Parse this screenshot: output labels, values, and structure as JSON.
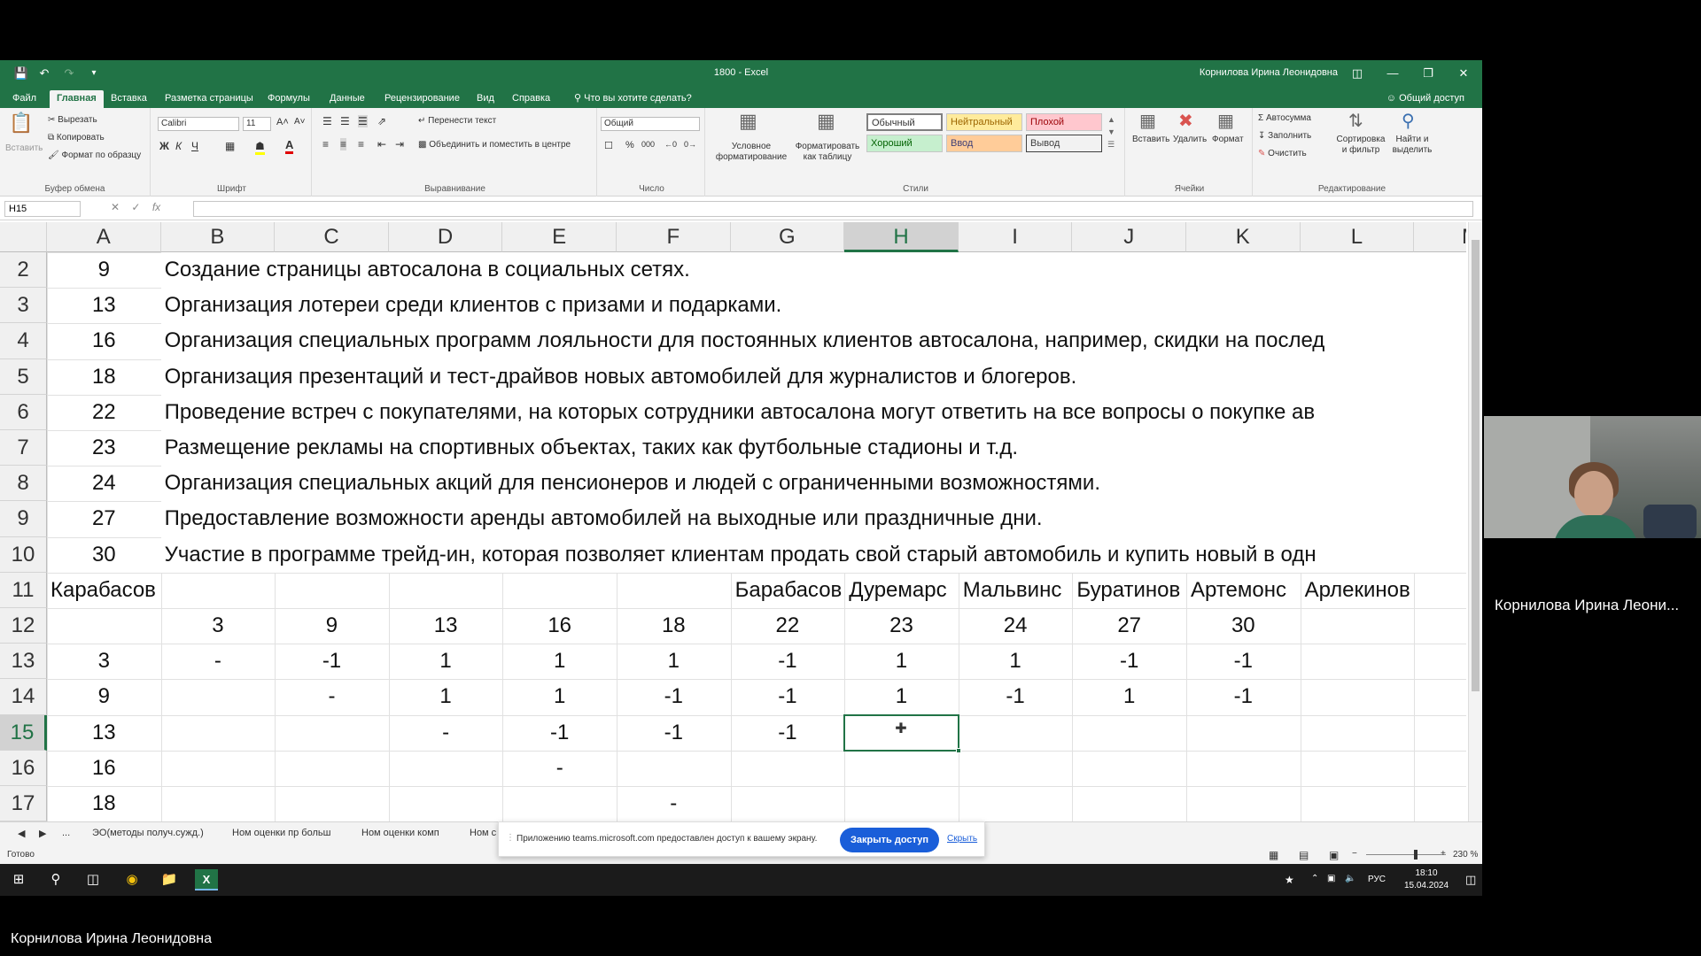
{
  "window": {
    "title": "1800  -  Excel",
    "user": "Корнилова Ирина Леонидовна"
  },
  "tabs": [
    "Файл",
    "Главная",
    "Вставка",
    "Разметка страницы",
    "Формулы",
    "Данные",
    "Рецензирование",
    "Вид",
    "Справка"
  ],
  "tell_me": "Что вы хотите сделать?",
  "share_label": "Общий доступ",
  "ribbon": {
    "clipboard": {
      "paste": "Вставить",
      "cut": "Вырезать",
      "copy": "Копировать",
      "format_painter": "Формат по образцу",
      "group": "Буфер обмена"
    },
    "font": {
      "name": "Calibri",
      "size": "11",
      "group": "Шрифт",
      "bold": "Ж",
      "italic": "К",
      "underline": "Ч"
    },
    "alignment": {
      "wrap": "Перенести текст",
      "merge": "Объединить и поместить в центре",
      "group": "Выравнивание"
    },
    "number": {
      "format": "Общий",
      "group": "Число"
    },
    "styles": {
      "cond": "Условное форматирование",
      "table": "Форматировать как таблицу",
      "normal": "Обычный",
      "neutral": "Нейтральный",
      "bad": "Плохой",
      "good": "Хороший",
      "input": "Ввод",
      "output": "Вывод",
      "group": "Стили",
      "colors": {
        "neutral": "#ffeb9c",
        "bad": "#ffc7ce",
        "good": "#c6efce",
        "input": "#ffcc99",
        "output": "#f2f2f2"
      }
    },
    "cells": {
      "insert": "Вставить",
      "delete": "Удалить",
      "format": "Формат",
      "group": "Ячейки"
    },
    "editing": {
      "autosum": "Автосумма",
      "fill": "Заполнить",
      "clear": "Очистить",
      "sort": "Сортировка и фильтр",
      "find": "Найти и выделить",
      "group": "Редактирование"
    }
  },
  "formula_bar": {
    "name_box": "H15",
    "fx": "fx",
    "value": ""
  },
  "columns": [
    "A",
    "B",
    "C",
    "D",
    "E",
    "F",
    "G",
    "H",
    "I",
    "J",
    "K",
    "L",
    "M"
  ],
  "rows": [
    {
      "n": "2",
      "a": "9",
      "text": "Создание страницы автосалона в социальных сетях."
    },
    {
      "n": "3",
      "a": "13",
      "text": "Организация лотереи среди клиентов с призами и подарками."
    },
    {
      "n": "4",
      "a": "16",
      "text": "Организация специальных программ лояльности для постоянных клиентов автосалона, например, скидки на послед"
    },
    {
      "n": "5",
      "a": "18",
      "text": "Организация презентаций и тест-драйвов новых автомобилей для журналистов и блогеров."
    },
    {
      "n": "6",
      "a": "22",
      "text": "Проведение встреч с покупателями, на которых сотрудники автосалона могут ответить на все вопросы о покупке ав"
    },
    {
      "n": "7",
      "a": "23",
      "text": "Размещение рекламы на спортивных объектах, таких как футбольные стадионы и т.д."
    },
    {
      "n": "8",
      "a": "24",
      "text": "Организация специальных акций для пенсионеров и людей с ограниченными возможностями."
    },
    {
      "n": "9",
      "a": "27",
      "text": "Предоставление возможности аренды автомобилей на выходные или праздничные дни."
    },
    {
      "n": "10",
      "a": "30",
      "text": "Участие в программе трейд-ин, которая позволяет клиентам продать свой старый автомобиль и купить новый в одн"
    }
  ],
  "row11": {
    "n": "11",
    "a": "Карабасов",
    "g": "Барабасов",
    "h": "Дуремарс",
    "i": "Мальвинс",
    "j": "Буратинов",
    "k": "Артемонс",
    "l": "Арлекинов"
  },
  "matrix_rows": [
    {
      "n": "12",
      "a": "",
      "cells": [
        "3",
        "9",
        "13",
        "16",
        "18",
        "22",
        "23",
        "24",
        "27",
        "30"
      ]
    },
    {
      "n": "13",
      "a": "3",
      "cells": [
        "-",
        "-1",
        "1",
        "1",
        "1",
        "-1",
        "1",
        "1",
        "-1",
        "-1"
      ]
    },
    {
      "n": "14",
      "a": "9",
      "cells": [
        "",
        "-",
        "1",
        "1",
        "-1",
        "-1",
        "1",
        "-1",
        "1",
        "-1"
      ]
    },
    {
      "n": "15",
      "a": "13",
      "cells": [
        "",
        "",
        "-",
        "-1",
        "-1",
        "-1",
        "",
        "",
        "",
        ""
      ]
    },
    {
      "n": "16",
      "a": "16",
      "cells": [
        "",
        "",
        "",
        "-",
        "",
        "",
        "",
        "",
        "",
        ""
      ]
    },
    {
      "n": "17",
      "a": "18",
      "cells": [
        "",
        "",
        "",
        "",
        "-",
        "",
        "",
        "",
        "",
        ""
      ]
    }
  ],
  "sheet_tabs": [
    "...",
    "ЭО(методы получ.сужд.)",
    "Ном оценки пр больш",
    "Ном оценки комп",
    "Ном с"
  ],
  "status": {
    "ready": "Готово",
    "zoom": "230 %"
  },
  "share_bar": {
    "text": "Приложению teams.microsoft.com предоставлен доступ к вашему экрану.",
    "stop": "Закрыть доступ",
    "hide": "Скрыть"
  },
  "taskbar": {
    "lang": "РУС",
    "time": "18:10",
    "date": "15.04.2024"
  },
  "participant": {
    "name": "Корнилова Ирина Леони...",
    "full_name": "Корнилова Ирина Леонидовна"
  }
}
